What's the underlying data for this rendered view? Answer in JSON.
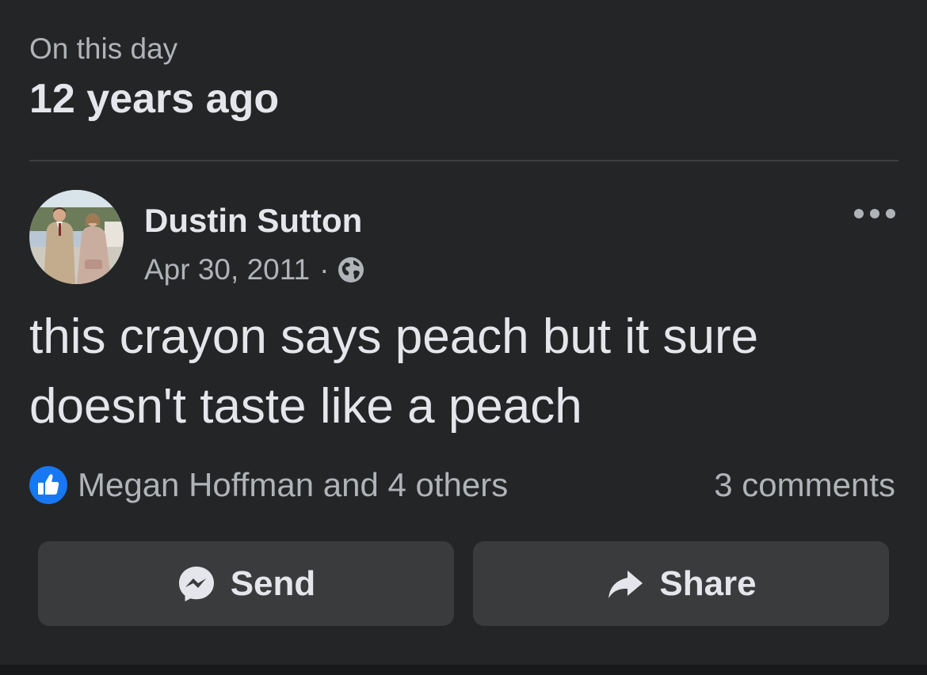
{
  "memories": {
    "label": "On this day",
    "title": "12 years ago"
  },
  "post": {
    "author": "Dustin Sutton",
    "date": "Apr 30, 2011",
    "separator": "·",
    "audience_icon": "globe-icon",
    "more_icon": "more-options-icon",
    "text": "this crayon says peach but it sure doesn't taste like a peach"
  },
  "reactions": {
    "icon": "like-icon",
    "summary": "Megan Hoffman and 4 others",
    "comments": "3 comments"
  },
  "actions": {
    "send_label": "Send",
    "send_icon": "messenger-icon",
    "share_label": "Share",
    "share_icon": "share-arrow-icon"
  },
  "colors": {
    "background": "#242526",
    "primary_text": "#e4e6eb",
    "secondary_text": "#b0b3b8",
    "button_bg": "#3a3b3c",
    "like_blue": "#1877f2"
  }
}
